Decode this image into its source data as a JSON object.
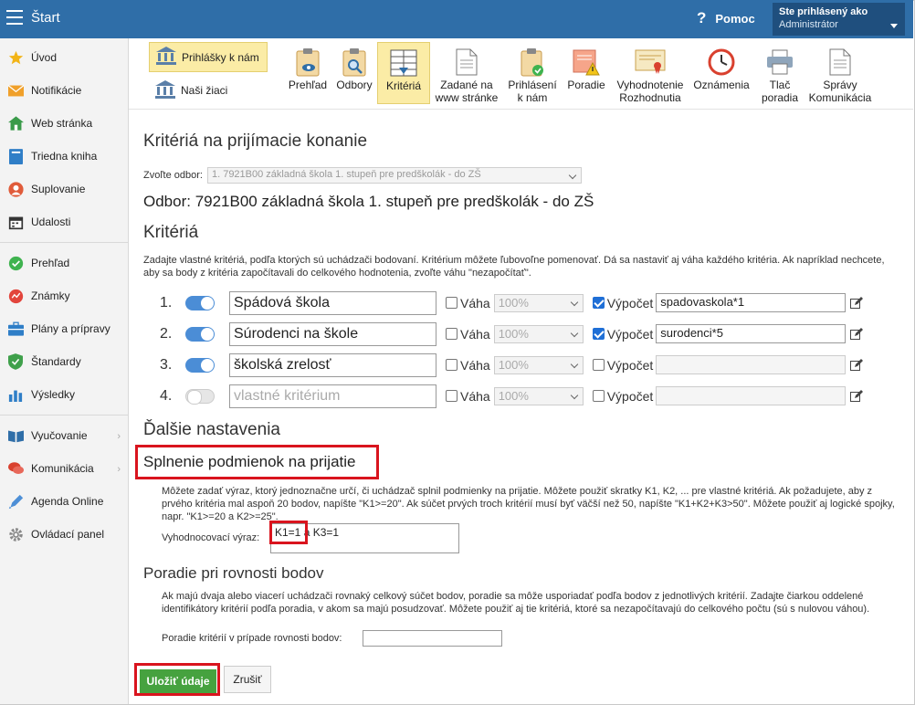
{
  "topbar": {
    "title": "Štart",
    "help_label": "Pomoc",
    "user_line1": "Ste prihlásený ako",
    "user_line2": "Administrátor"
  },
  "sidebar": {
    "items": [
      {
        "label": "Úvod",
        "icon": "star-icon"
      },
      {
        "label": "Notifikácie",
        "icon": "envelope-icon"
      },
      {
        "label": "Web stránka",
        "icon": "home-icon"
      },
      {
        "label": "Triedna kniha",
        "icon": "book-icon"
      },
      {
        "label": "Suplovanie",
        "icon": "person-icon"
      },
      {
        "label": "Udalosti",
        "icon": "calendar-icon"
      },
      {
        "label": "Prehľad",
        "icon": "check-circle-icon"
      },
      {
        "label": "Známky",
        "icon": "grade-icon"
      },
      {
        "label": "Plány a prípravy",
        "icon": "briefcase-icon"
      },
      {
        "label": "Štandardy",
        "icon": "shield-icon"
      },
      {
        "label": "Výsledky",
        "icon": "bar-chart-icon"
      },
      {
        "label": "Vyučovanie",
        "icon": "book-open-icon"
      },
      {
        "label": "Komunikácia",
        "icon": "chat-icon"
      },
      {
        "label": "Agenda Online",
        "icon": "pen-icon"
      },
      {
        "label": "Ovládací panel",
        "icon": "gear-icon"
      }
    ]
  },
  "toolbar": {
    "left_main": "Prihlášky k nám",
    "left_second": "Naši žiaci",
    "items": [
      {
        "label": "Prehľad"
      },
      {
        "label": "Odbory"
      },
      {
        "label": "Kritériá"
      },
      {
        "label": "Zadané na\nwww stránke"
      },
      {
        "label": "Prihlásení\nk nám"
      },
      {
        "label": "Poradie"
      },
      {
        "label": "Vyhodnotenie\nRozhodnutia"
      },
      {
        "label": "Oznámenia"
      },
      {
        "label": "Tlač\nporadia"
      },
      {
        "label": "Správy\nKomunikácia"
      }
    ]
  },
  "page": {
    "title": "Kritériá na prijímacie konanie",
    "odbor_label": "Zvoľte odbor:",
    "odbor_select": "1. 7921B00 základná škola 1. stupeň pre predškolák - do ZŠ",
    "odbor_title": "Odbor: 7921B00 základná škola 1. stupeň pre predškolák - do ZŠ",
    "criteria_heading": "Kritériá",
    "criteria_desc": "Zadajte vlastné kritériá, podľa ktorých sú uchádzači bodovaní. Kritérium môžete ľubovoľne pomenovať. Dá sa nastaviť aj váha každého kritéria. Ak napríklad nechcete, aby sa body z kritéria započítavali do celkového hodnotenia, zvoľte váhu \"nezapočítať\".",
    "weight_label": "Váha",
    "calc_label": "Výpočet",
    "criteria": [
      {
        "num": "1.",
        "name": "Spádová škola",
        "weight": "100%",
        "calc": "spadovaskola*1"
      },
      {
        "num": "2.",
        "name": "Súrodenci na škole",
        "weight": "100%",
        "calc": "surodenci*5"
      },
      {
        "num": "3.",
        "name": "školská zrelosť",
        "weight": "100%",
        "calc": ""
      },
      {
        "num": "4.",
        "name": "vlastné kritérium",
        "weight": "100%",
        "calc": ""
      }
    ],
    "more_heading": "Ďalšie nastavenia",
    "conditions_heading": "Splnenie podmienok na prijatie",
    "conditions_desc": "Môžete zadať výraz, ktorý jednoznačne určí, či uchádzač splnil podmienky na prijatie. Môžete použiť skratky K1, K2, ... pre vlastné kritériá. Ak požadujete, aby z prvého kritéria mal aspoň 20 bodov, napíšte \"K1>=20\". Ak súčet prvých troch kritérií musí byť väčší než 50, napíšte \"K1+K2+K3>50\". Môžete použiť aj logické spojky, napr. \"K1>=20 a K2>=25\".",
    "expr_label": "Vyhodnocovací výraz:",
    "expr_value": "K1=1 a K3=1",
    "tie_heading": "Poradie pri rovnosti bodov",
    "tie_desc": "Ak majú dvaja alebo viacerí uchádzači rovnaký celkový súčet bodov, poradie sa môže usporiadať podľa bodov z jednotlivých kritérií. Zadajte čiarkou oddelené identifikátory kritérií podľa poradia, v akom sa majú posudzovať. Môžete použiť aj tie kritériá, ktoré sa nezapočítavajú do celkového počtu (sú s nulovou váhou).",
    "tie_label": "Poradie kritérií v prípade rovnosti bodov:",
    "tie_value": "",
    "save_label": "Uložiť údaje",
    "cancel_label": "Zrušiť"
  }
}
